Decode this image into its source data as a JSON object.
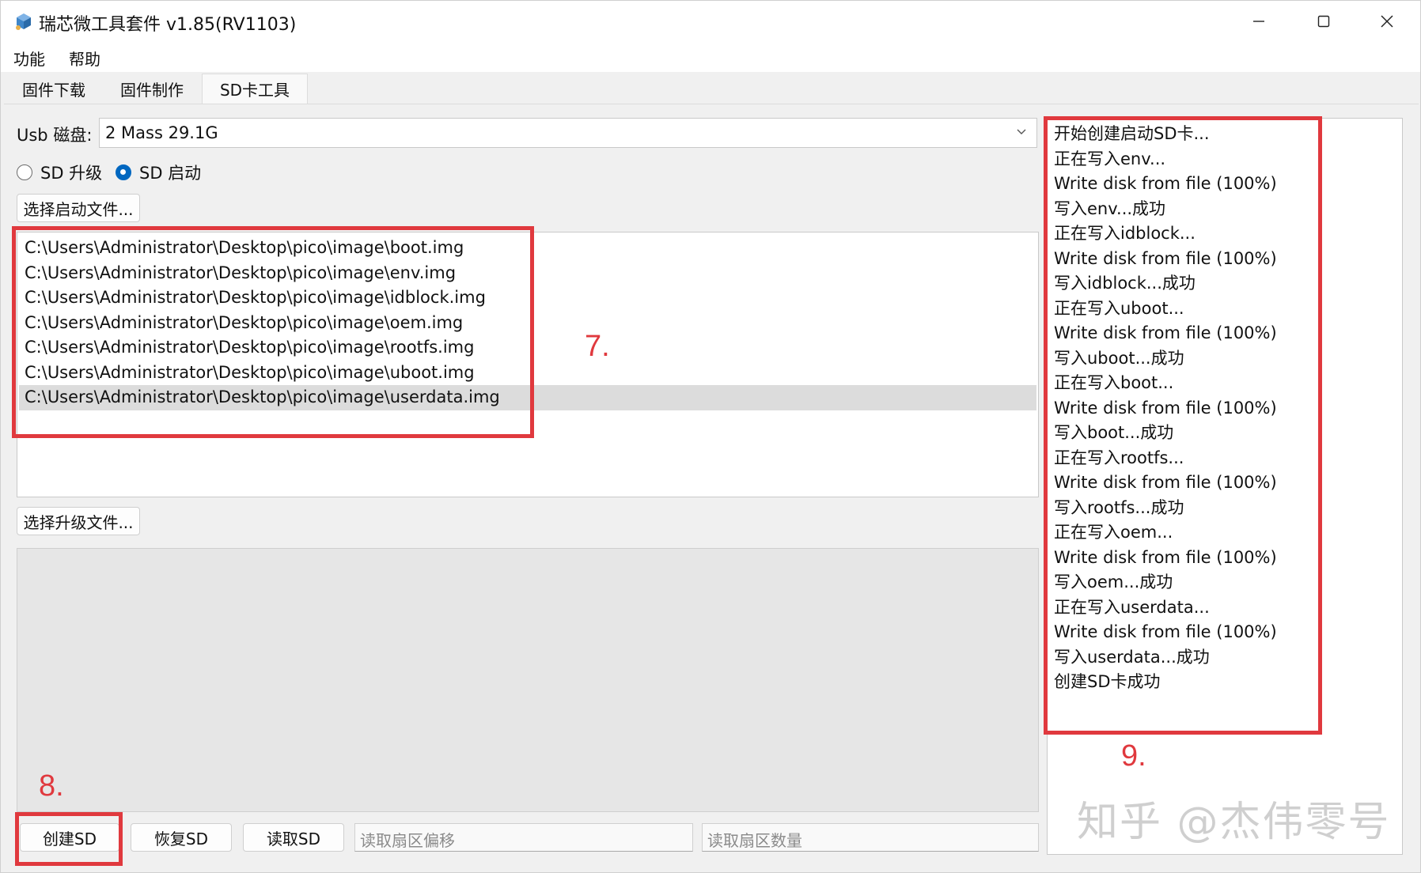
{
  "window": {
    "title": "瑞芯微工具套件 v1.85(RV1103)"
  },
  "menu": [
    "功能",
    "帮助"
  ],
  "tabs": [
    {
      "label": "固件下载",
      "active": false
    },
    {
      "label": "固件制作",
      "active": false
    },
    {
      "label": "SD卡工具",
      "active": true
    }
  ],
  "usb": {
    "label": "Usb 磁盘:",
    "value": "2 Mass 29.1G"
  },
  "mode": {
    "upgrade_label": "SD 升级",
    "boot_label": "SD 启动",
    "selected": "boot"
  },
  "buttons": {
    "select_boot": "选择启动文件...",
    "select_upgrade": "选择升级文件...",
    "create": "创建SD",
    "restore": "恢复SD",
    "read": "读取SD"
  },
  "inputs": {
    "offset_placeholder": "读取扇区偏移",
    "count_placeholder": "读取扇区数量"
  },
  "files": [
    "C:\\Users\\Administrator\\Desktop\\pico\\image\\boot.img",
    "C:\\Users\\Administrator\\Desktop\\pico\\image\\env.img",
    "C:\\Users\\Administrator\\Desktop\\pico\\image\\idblock.img",
    "C:\\Users\\Administrator\\Desktop\\pico\\image\\oem.img",
    "C:\\Users\\Administrator\\Desktop\\pico\\image\\rootfs.img",
    "C:\\Users\\Administrator\\Desktop\\pico\\image\\uboot.img",
    "C:\\Users\\Administrator\\Desktop\\pico\\image\\userdata.img"
  ],
  "selected_file_index": 6,
  "log": [
    "开始创建启动SD卡...",
    "正在写入env...",
    "Write disk from file (100%)",
    "写入env...成功",
    "正在写入idblock...",
    "Write disk from file (100%)",
    "写入idblock...成功",
    "正在写入uboot...",
    "Write disk from file (100%)",
    "写入uboot...成功",
    "正在写入boot...",
    "Write disk from file (100%)",
    "写入boot...成功",
    "正在写入rootfs...",
    "Write disk from file (100%)",
    "写入rootfs...成功",
    "正在写入oem...",
    "Write disk from file (100%)",
    "写入oem...成功",
    "正在写入userdata...",
    "Write disk from file (100%)",
    "写入userdata...成功",
    "创建SD卡成功"
  ],
  "annotations": {
    "files_box": "7.",
    "create_box": "8.",
    "log_box": "9.",
    "color": "#e0393e"
  },
  "watermark": "知乎 @杰伟零号",
  "icons": {
    "app": "app-icon",
    "minimize": "minimize-icon",
    "maximize": "maximize-icon",
    "close": "close-icon",
    "dropdown": "chevron-down-icon"
  }
}
